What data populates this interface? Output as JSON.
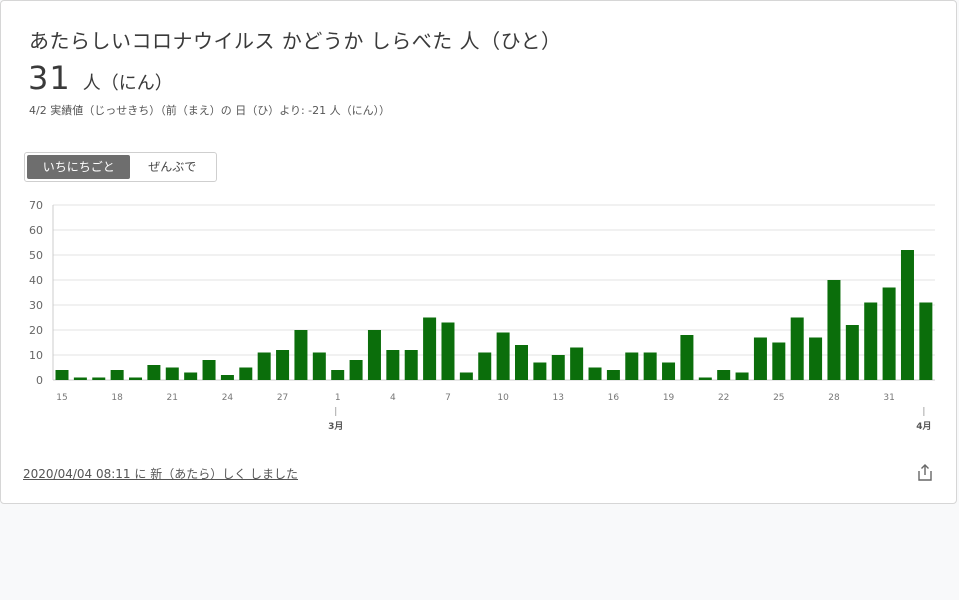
{
  "header": {
    "title": "あたらしいコロナウイルス かどうか しらべた 人（ひと）",
    "count": "31",
    "count_unit": "人（にん）",
    "subtitle": "4/2 実績値（じっせきち）（前（まえ）の 日（ひ）より: -21 人（にん））"
  },
  "toggle": {
    "daily_label": "いちにちごと",
    "total_label": "ぜんぶで"
  },
  "footer": {
    "updated": "2020/04/04 08:11 に 新（あたら）しく しました"
  },
  "colors": {
    "bar": "#0b6e0b",
    "grid": "#e3e3e3",
    "axis": "#cccccc"
  },
  "chart_data": {
    "type": "bar",
    "series": [
      {
        "values": [
          4,
          1,
          1,
          4,
          1,
          6,
          5,
          3,
          8,
          2,
          5,
          11,
          12,
          20,
          11,
          4,
          8,
          20,
          12,
          12,
          25,
          23,
          3,
          11,
          19,
          14,
          7,
          10,
          13,
          5,
          4,
          11,
          11,
          7,
          18,
          1,
          4,
          3,
          17,
          15,
          25,
          17,
          40,
          22,
          31,
          37,
          52,
          31
        ]
      }
    ],
    "ylim": [
      0,
      70
    ],
    "yticks": [
      0,
      10,
      20,
      30,
      40,
      50,
      60,
      70
    ],
    "x_tick_labels": [
      {
        "index": 0,
        "label": "15"
      },
      {
        "index": 3,
        "label": "18"
      },
      {
        "index": 6,
        "label": "21"
      },
      {
        "index": 9,
        "label": "24"
      },
      {
        "index": 12,
        "label": "27"
      },
      {
        "index": 15,
        "label": "1"
      },
      {
        "index": 18,
        "label": "4"
      },
      {
        "index": 21,
        "label": "7"
      },
      {
        "index": 24,
        "label": "10"
      },
      {
        "index": 27,
        "label": "13"
      },
      {
        "index": 30,
        "label": "16"
      },
      {
        "index": 33,
        "label": "19"
      },
      {
        "index": 36,
        "label": "22"
      },
      {
        "index": 39,
        "label": "25"
      },
      {
        "index": 42,
        "label": "28"
      },
      {
        "index": 45,
        "label": "31"
      }
    ],
    "month_labels": [
      {
        "index": 15,
        "label": "3月"
      },
      {
        "index": 47,
        "label": "4月"
      }
    ],
    "grid": true,
    "legend": "none"
  }
}
